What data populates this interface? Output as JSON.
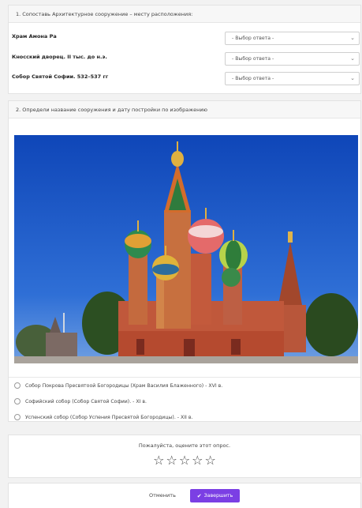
{
  "q1": {
    "title": "1. Сопоставь Архитектурное сооружение – месту расположения:",
    "rows": [
      {
        "label": "Храм Амона Ра",
        "select_value": "- Выбор ответа -"
      },
      {
        "label": "Кносский дворец. II тыс. до н.э.",
        "select_value": "- Выбор ответа -"
      },
      {
        "label": "Собор Святой Софии. 532–537 гг",
        "select_value": "- Выбор ответа -"
      }
    ]
  },
  "q2": {
    "title": "2. Определи название сооружения и дату постройки по изображению",
    "options": [
      {
        "label": "Собор Покрова Пресвятоой Богородицы (Храм Василия Блаженного) - XVI в."
      },
      {
        "label": "Софийский собор (Собор Святой Софии). - XI в."
      },
      {
        "label": "Успенский собор (Собор Успения Пресвятой Богородицы). - XII в."
      }
    ]
  },
  "rating": {
    "prompt": "Пожалуйста, оцените этот опрос.",
    "star_glyph": "☆",
    "star_count": 5
  },
  "footer": {
    "cancel_label": "Отменить",
    "finish_label": "Завершить"
  },
  "colors": {
    "accent": "#7b3fe4",
    "sky": "#1f58c4"
  }
}
